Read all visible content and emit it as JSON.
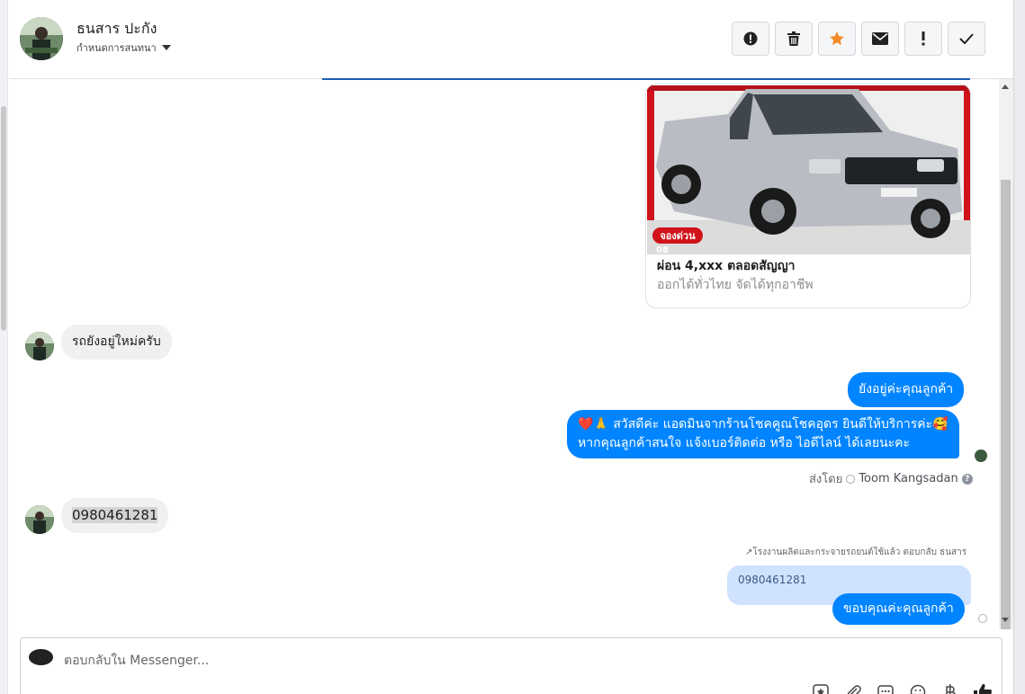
{
  "header": {
    "contact_name": "ธนสาร ปะกัง",
    "assign_label": "กำหนดการสนทนา",
    "actions": [
      {
        "name": "spam",
        "icon": "exclamation-circle-icon"
      },
      {
        "name": "delete",
        "icon": "trash-icon"
      },
      {
        "name": "star",
        "icon": "star-icon"
      },
      {
        "name": "mark-unread",
        "icon": "envelope-icon"
      },
      {
        "name": "follow-up",
        "icon": "exclamation-icon"
      },
      {
        "name": "mark-done",
        "icon": "check-icon"
      }
    ]
  },
  "conversation": {
    "product_card": {
      "badge": "จองด่วน",
      "phone_partial": "08",
      "title": "ผ่อน 4,xxx ตลอดสัญญา",
      "subtitle": "ออกได้ทั่วไทย จัดได้ทุกอาชีพ"
    },
    "msg_in_1": "รถยังอยู่ใหม่ครับ",
    "msg_out_1": "ยังอยู่ค่ะคุณลูกค้า",
    "msg_out_2_line1": "❤️🙏 สวัสดีค่ะ แอดมินจากร้านโชคคูณโชคอุดร ยินดีให้บริการค่ะ🥰",
    "msg_out_2_line2": "หากคุณลูกค้าสนใจ แจ้งเบอร์ติดต่อ หรือ ไอดีไลน์ ได้เลยนะคะ",
    "sent_by_label": "ส่งโดย",
    "sent_by_name": "Toom Kangsadan",
    "msg_in_2": "0980461281",
    "reply_note": "↗โรงงานผลิตและกระจายรถยนต์ใช้แล้ว ตอบกลับ ธนสาร",
    "quoted_text": "0980461281",
    "msg_out_3": "ขอบคุณค่ะคุณลูกค้า"
  },
  "composer": {
    "placeholder": "ตอบกลับใน Messenger..."
  },
  "colors": {
    "outgoing": "#0084ff",
    "incoming": "#f0f0f0",
    "star": "#f28c28"
  }
}
